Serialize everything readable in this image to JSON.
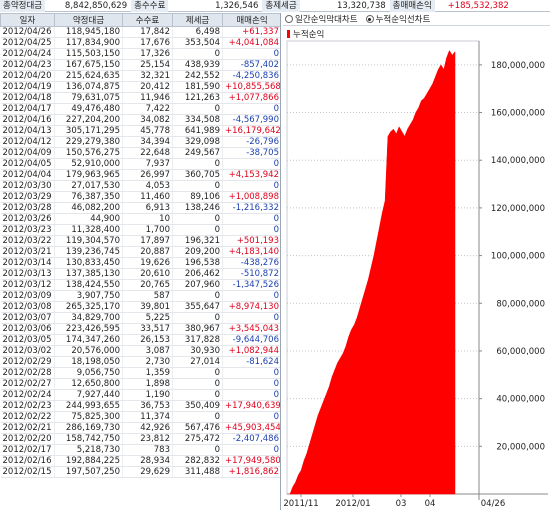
{
  "summary": [
    {
      "label": "총약정대금",
      "value": "8,842,850,629"
    },
    {
      "label": "총수수료",
      "value": "1,326,546"
    },
    {
      "label": "총제세금",
      "value": "13,320,738"
    },
    {
      "label": "총매매손익",
      "value": "+185,532,382",
      "sign": "pos"
    }
  ],
  "table": {
    "headers": [
      "일자",
      "약정대금",
      "수수료",
      "제세금",
      "매매손익"
    ],
    "rows": [
      [
        "2012/04/26",
        "118,945,180",
        "17,842",
        "6,498",
        "+61,337",
        "pos"
      ],
      [
        "2012/04/25",
        "117,834,900",
        "17,676",
        "353,504",
        "+4,041,084",
        "pos"
      ],
      [
        "2012/04/24",
        "115,503,150",
        "17,326",
        "0",
        "0",
        "zero"
      ],
      [
        "2012/04/23",
        "167,675,150",
        "25,154",
        "438,939",
        "-857,402",
        "neg"
      ],
      [
        "2012/04/20",
        "215,624,635",
        "32,321",
        "242,552",
        "-4,250,836",
        "neg"
      ],
      [
        "2012/04/19",
        "136,074,875",
        "20,412",
        "181,590",
        "+10,855,568",
        "pos"
      ],
      [
        "2012/04/18",
        "79,631,075",
        "11,946",
        "121,263",
        "+1,077,866",
        "pos"
      ],
      [
        "2012/04/17",
        "49,476,480",
        "7,422",
        "0",
        "0",
        "zero"
      ],
      [
        "2012/04/16",
        "227,204,200",
        "34,082",
        "334,508",
        "-4,567,990",
        "neg"
      ],
      [
        "2012/04/13",
        "305,171,295",
        "45,778",
        "641,989",
        "+16,179,642",
        "pos"
      ],
      [
        "2012/04/12",
        "229,279,380",
        "34,394",
        "329,098",
        "-26,796",
        "neg"
      ],
      [
        "2012/04/09",
        "150,576,275",
        "22,648",
        "249,567",
        "-38,705",
        "neg"
      ],
      [
        "2012/04/05",
        "52,910,000",
        "7,937",
        "0",
        "0",
        "zero"
      ],
      [
        "2012/04/04",
        "179,963,965",
        "26,997",
        "360,705",
        "+4,153,942",
        "pos"
      ],
      [
        "2012/03/30",
        "27,017,530",
        "4,053",
        "0",
        "0",
        "zero"
      ],
      [
        "2012/03/29",
        "76,387,350",
        "11,460",
        "89,106",
        "+1,008,898",
        "pos"
      ],
      [
        "2012/03/28",
        "46,082,200",
        "6,913",
        "138,246",
        "-1,216,332",
        "neg"
      ],
      [
        "2012/03/26",
        "44,900",
        "10",
        "0",
        "0",
        "zero"
      ],
      [
        "2012/03/23",
        "11,328,400",
        "1,700",
        "0",
        "0",
        "zero"
      ],
      [
        "2012/03/22",
        "119,304,570",
        "17,897",
        "196,321",
        "+501,193",
        "pos"
      ],
      [
        "2012/03/21",
        "139,236,745",
        "20,887",
        "209,200",
        "+4,183,140",
        "pos"
      ],
      [
        "2012/03/14",
        "130,833,450",
        "19,626",
        "196,538",
        "-438,276",
        "neg"
      ],
      [
        "2012/03/13",
        "137,385,130",
        "20,610",
        "206,462",
        "-510,872",
        "neg"
      ],
      [
        "2012/03/12",
        "138,424,550",
        "20,765",
        "207,960",
        "-1,347,526",
        "neg"
      ],
      [
        "2012/03/09",
        "3,907,750",
        "587",
        "0",
        "0",
        "zero"
      ],
      [
        "2012/03/08",
        "265,325,170",
        "39,801",
        "355,647",
        "+8,974,130",
        "pos"
      ],
      [
        "2012/03/07",
        "34,829,700",
        "5,225",
        "0",
        "0",
        "zero"
      ],
      [
        "2012/03/06",
        "223,426,595",
        "33,517",
        "380,967",
        "+3,545,043",
        "pos"
      ],
      [
        "2012/03/05",
        "174,347,260",
        "26,153",
        "317,828",
        "-9,644,706",
        "neg"
      ],
      [
        "2012/03/02",
        "20,576,000",
        "3,087",
        "30,930",
        "+1,082,944",
        "pos"
      ],
      [
        "2012/02/29",
        "18,198,050",
        "2,730",
        "27,014",
        "-81,624",
        "neg"
      ],
      [
        "2012/02/28",
        "9,056,750",
        "1,359",
        "0",
        "0",
        "zero"
      ],
      [
        "2012/02/27",
        "12,650,800",
        "1,898",
        "0",
        "0",
        "zero"
      ],
      [
        "2012/02/24",
        "7,927,440",
        "1,190",
        "0",
        "0",
        "zero"
      ],
      [
        "2012/02/23",
        "244,993,655",
        "36,753",
        "350,409",
        "+17,940,639",
        "pos"
      ],
      [
        "2012/02/22",
        "75,825,300",
        "11,374",
        "0",
        "0",
        "zero"
      ],
      [
        "2012/02/21",
        "286,169,730",
        "42,926",
        "567,476",
        "+45,903,454",
        "pos"
      ],
      [
        "2012/02/20",
        "158,742,750",
        "23,812",
        "275,472",
        "-2,407,486",
        "neg"
      ],
      [
        "2012/02/17",
        "5,218,730",
        "783",
        "0",
        "0",
        "zero"
      ],
      [
        "2012/02/16",
        "192,884,225",
        "28,934",
        "282,832",
        "+17,949,580",
        "pos"
      ],
      [
        "2012/02/15",
        "197,507,250",
        "29,629",
        "311,488",
        "+1,816,862",
        "pos"
      ]
    ]
  },
  "chart_options": [
    {
      "label": "일간순익막대차트",
      "selected": false
    },
    {
      "label": "누적순익선차트",
      "selected": true
    }
  ],
  "chart_data": {
    "type": "area",
    "series": [
      {
        "name": "누적순익",
        "color": "#ff0000"
      }
    ],
    "ylim": [
      0,
      190000000
    ],
    "y_ticks": [
      20000000,
      40000000,
      60000000,
      80000000,
      100000000,
      120000000,
      140000000,
      160000000,
      180000000
    ],
    "y_tick_labels": [
      "20,000,000",
      "40,000,000",
      "60,000,000",
      "80,000,000",
      "100,000,000",
      "120,000,000",
      "140,000,000",
      "160,000,000",
      "180,000,000"
    ],
    "x_ticks": [
      "2011/11",
      "2012/01",
      "03",
      "04"
    ],
    "x_end_label": "04/26",
    "values": [
      0,
      3000000,
      5000000,
      8000000,
      10000000,
      14000000,
      17000000,
      21000000,
      25000000,
      29000000,
      33000000,
      36000000,
      39000000,
      42000000,
      45000000,
      49000000,
      52000000,
      55000000,
      57000000,
      59000000,
      62000000,
      66000000,
      69000000,
      71000000,
      74000000,
      78000000,
      82000000,
      86000000,
      90000000,
      95000000,
      100000000,
      106000000,
      112000000,
      118000000,
      123000000,
      150000000,
      152000000,
      153000000,
      151000000,
      154000000,
      152000000,
      150000000,
      153000000,
      155000000,
      157000000,
      160000000,
      162000000,
      165000000,
      166000000,
      168000000,
      170000000,
      172000000,
      175000000,
      178000000,
      180000000,
      178000000,
      183000000,
      186000000,
      184000000,
      185500000
    ]
  }
}
